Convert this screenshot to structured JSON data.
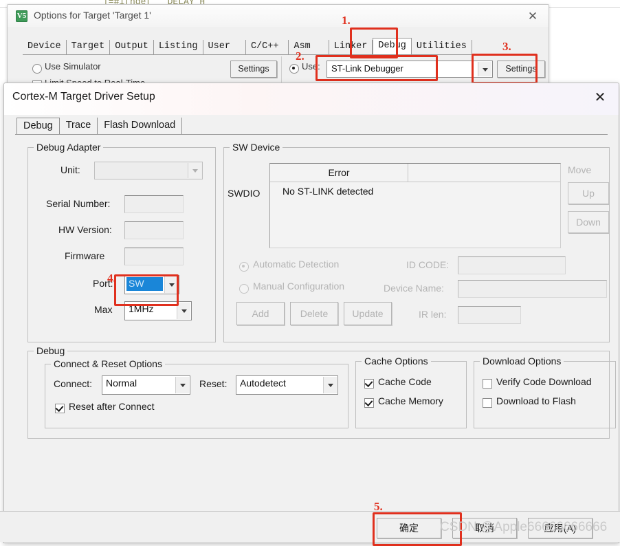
{
  "background": {
    "code_line": "|=#ifndef   DELAY_H"
  },
  "options_dialog": {
    "title": "Options for Target 'Target 1'",
    "icon": "keil-uvision-icon",
    "icon_glyph": "V5",
    "close_glyph": "✕",
    "tabs": [
      {
        "label": "Device",
        "active": false
      },
      {
        "label": "Target",
        "active": false
      },
      {
        "label": "Output",
        "active": false
      },
      {
        "label": "Listing",
        "active": false
      },
      {
        "label": "User",
        "active": false
      },
      {
        "label": "C/C++",
        "active": false
      },
      {
        "label": "Asm",
        "active": false
      },
      {
        "label": "Linker",
        "active": false
      },
      {
        "label": "Debug",
        "active": true
      },
      {
        "label": "Utilities",
        "active": false
      }
    ],
    "use_simulator_label": "Use Simulator",
    "limit_speed_label": "Limit Speed to Real-Time",
    "sim_settings_label": "Settings",
    "use_label": "Use:",
    "debugger_value": "ST-Link Debugger",
    "dbg_settings_label": "Settings"
  },
  "cortex_dialog": {
    "title": "Cortex-M Target Driver Setup",
    "close_glyph": "✕",
    "tabs": [
      {
        "label": "Debug",
        "active": true
      },
      {
        "label": "Trace",
        "active": false
      },
      {
        "label": "Flash Download",
        "active": false
      }
    ],
    "debug_adapter": {
      "legend": "Debug Adapter",
      "unit_label": "Unit:",
      "unit_value": "",
      "serial_label": "Serial Number:",
      "serial_value": "",
      "hw_label": "HW Version:",
      "hw_value": "",
      "firmware_label": "Firmware",
      "firmware_value": "",
      "port_label": "Port:",
      "port_value": "SW",
      "max_label": "Max",
      "max_value": "1MHz"
    },
    "sw_device": {
      "legend": "SW Device",
      "swdio_label": "SWDIO",
      "columns": [
        "Error",
        ""
      ],
      "rows": [
        [
          "No ST-LINK detected",
          ""
        ]
      ],
      "move_label": "Move",
      "up_label": "Up",
      "down_label": "Down",
      "auto_detect_label": "Automatic Detection",
      "manual_config_label": "Manual Configuration",
      "id_code_label": "ID CODE:",
      "id_code_value": "",
      "device_name_label": "Device Name:",
      "device_name_value": "",
      "ir_len_label": "IR len:",
      "ir_len_value": "",
      "add_label": "Add",
      "delete_label": "Delete",
      "update_label": "Update"
    },
    "debug_group": {
      "legend": "Debug",
      "connect_reset": {
        "legend": "Connect & Reset Options",
        "connect_label": "Connect:",
        "connect_value": "Normal",
        "reset_label": "Reset:",
        "reset_value": "Autodetect",
        "reset_after_connect_label": "Reset after Connect",
        "reset_after_connect_checked": true
      },
      "cache": {
        "legend": "Cache Options",
        "items": [
          {
            "label": "Cache Code",
            "checked": true
          },
          {
            "label": "Cache Memory",
            "checked": true
          }
        ]
      },
      "download": {
        "legend": "Download Options",
        "items": [
          {
            "label": "Verify Code Download",
            "checked": false
          },
          {
            "label": "Download to Flash",
            "checked": false
          }
        ]
      }
    }
  },
  "footer": {
    "ok_label": "确定",
    "cancel_label": "取消",
    "apply_label": "应用(A)"
  },
  "annotations": {
    "accent_color": "#e0301e",
    "steps": [
      {
        "num": "1.",
        "target": "debug-tab"
      },
      {
        "num": "2.",
        "target": "debugger-combo"
      },
      {
        "num": "3.",
        "target": "debugger-settings-button"
      },
      {
        "num": "4.",
        "target": "port-combo"
      },
      {
        "num": "5.",
        "target": "ok-button"
      }
    ]
  },
  "watermark": {
    "text": "CSDN @Apple66666666666"
  }
}
